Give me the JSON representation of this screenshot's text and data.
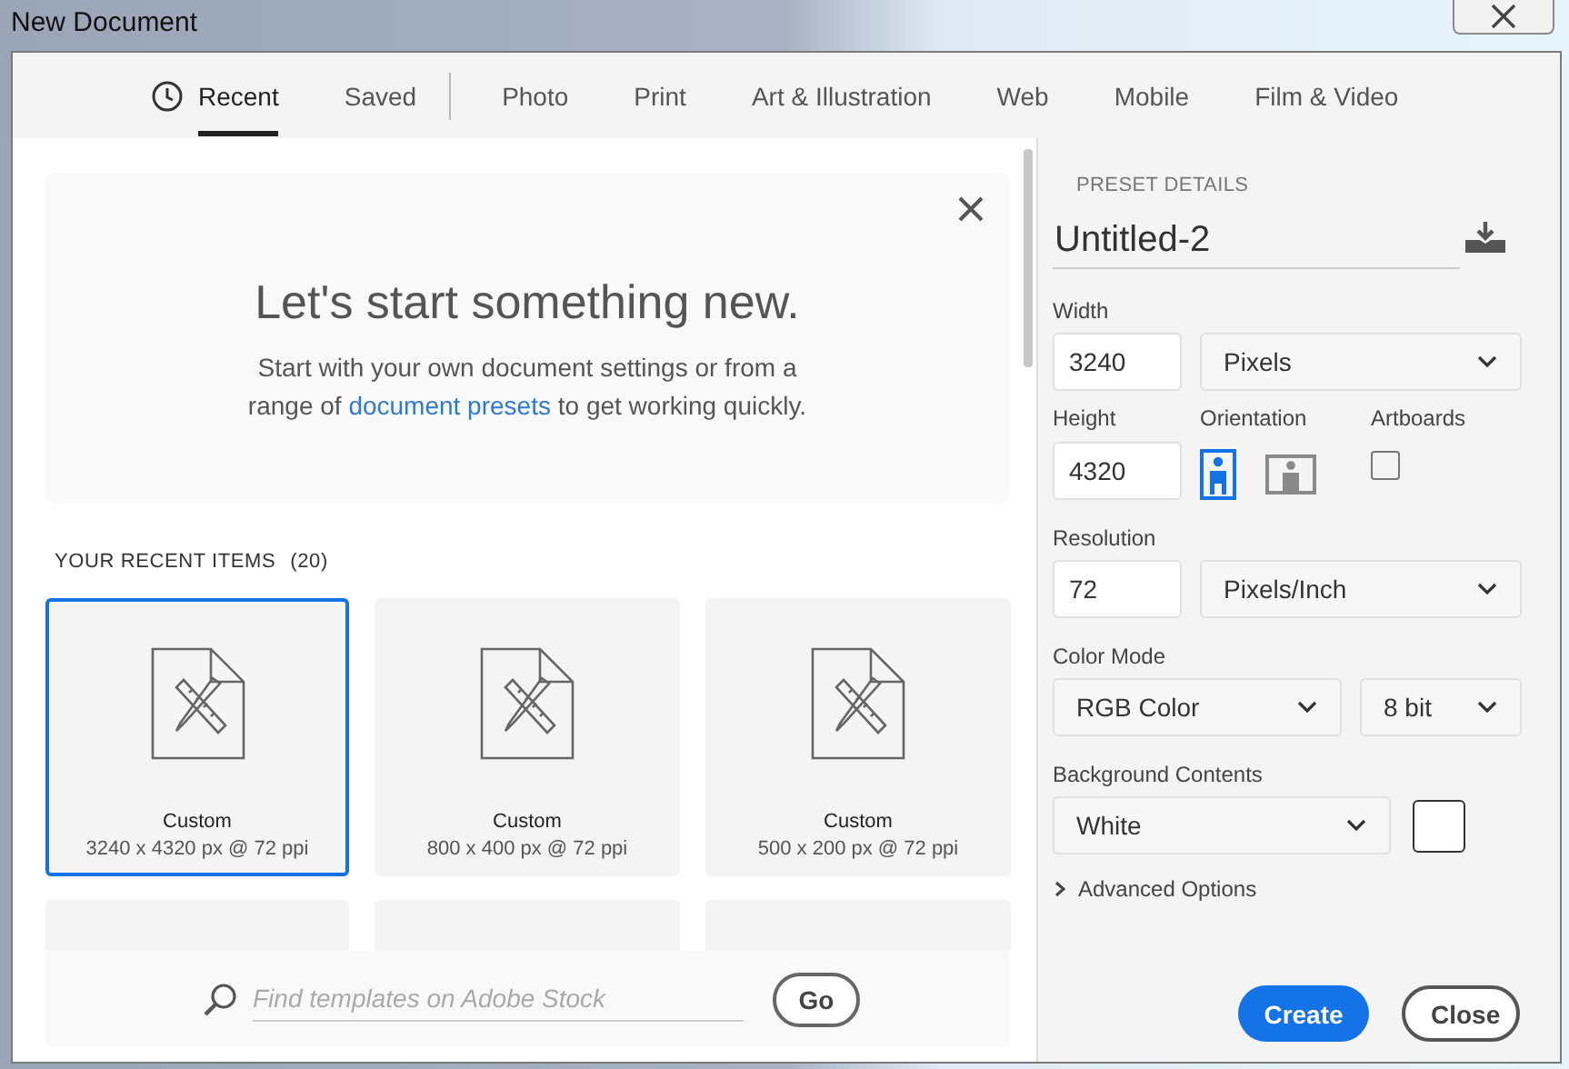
{
  "window": {
    "title": "New Document"
  },
  "tabs": [
    {
      "label": "Recent",
      "selected": true,
      "kind": "history",
      "divider_after": false
    },
    {
      "label": "Saved",
      "selected": false,
      "kind": "text",
      "divider_after": true
    },
    {
      "label": "Photo",
      "selected": false,
      "kind": "text",
      "divider_after": false
    },
    {
      "label": "Print",
      "selected": false,
      "kind": "text",
      "divider_after": false
    },
    {
      "label": "Art & Illustration",
      "selected": false,
      "kind": "text",
      "divider_after": false
    },
    {
      "label": "Web",
      "selected": false,
      "kind": "text",
      "divider_after": false
    },
    {
      "label": "Mobile",
      "selected": false,
      "kind": "text",
      "divider_after": false
    },
    {
      "label": "Film & Video",
      "selected": false,
      "kind": "text",
      "divider_after": false
    }
  ],
  "welcome": {
    "title": "Let's start something new.",
    "text_before": "Start with your own document settings or from a range of",
    "link": "document presets",
    "text_after": "to get working quickly."
  },
  "recent": {
    "heading": "YOUR RECENT ITEMS",
    "count": "(20)",
    "items": [
      {
        "name": "Custom",
        "size": "3240 x 4320 px @ 72 ppi",
        "selected": true
      },
      {
        "name": "Custom",
        "size": "800 x 400 px @ 72 ppi",
        "selected": false
      },
      {
        "name": "Custom",
        "size": "500 x 200 px @ 72 ppi",
        "selected": false
      }
    ]
  },
  "search": {
    "placeholder": "Find templates on Adobe Stock",
    "button": "Go"
  },
  "preset": {
    "heading": "PRESET DETAILS",
    "name": "Untitled-2",
    "width": {
      "label": "Width",
      "value": "3240",
      "unit": "Pixels"
    },
    "height": {
      "label": "Height",
      "value": "4320"
    },
    "orientation": {
      "label": "Orientation",
      "options": [
        {
          "kind": "portrait",
          "selected": true
        },
        {
          "kind": "landscape",
          "selected": false
        }
      ]
    },
    "artboards": {
      "label": "Artboards",
      "checked": false
    },
    "resolution": {
      "label": "Resolution",
      "value": "72",
      "unit": "Pixels/Inch"
    },
    "color_mode": {
      "label": "Color Mode",
      "value": "RGB Color",
      "depth": "8 bit"
    },
    "background": {
      "label": "Background Contents",
      "value": "White",
      "color": "#ffffff"
    },
    "advanced": {
      "label": "Advanced Options",
      "expanded": false
    }
  },
  "buttons": [
    {
      "label": "Create",
      "kind": "primary"
    },
    {
      "label": "Close",
      "kind": "secondary"
    }
  ]
}
